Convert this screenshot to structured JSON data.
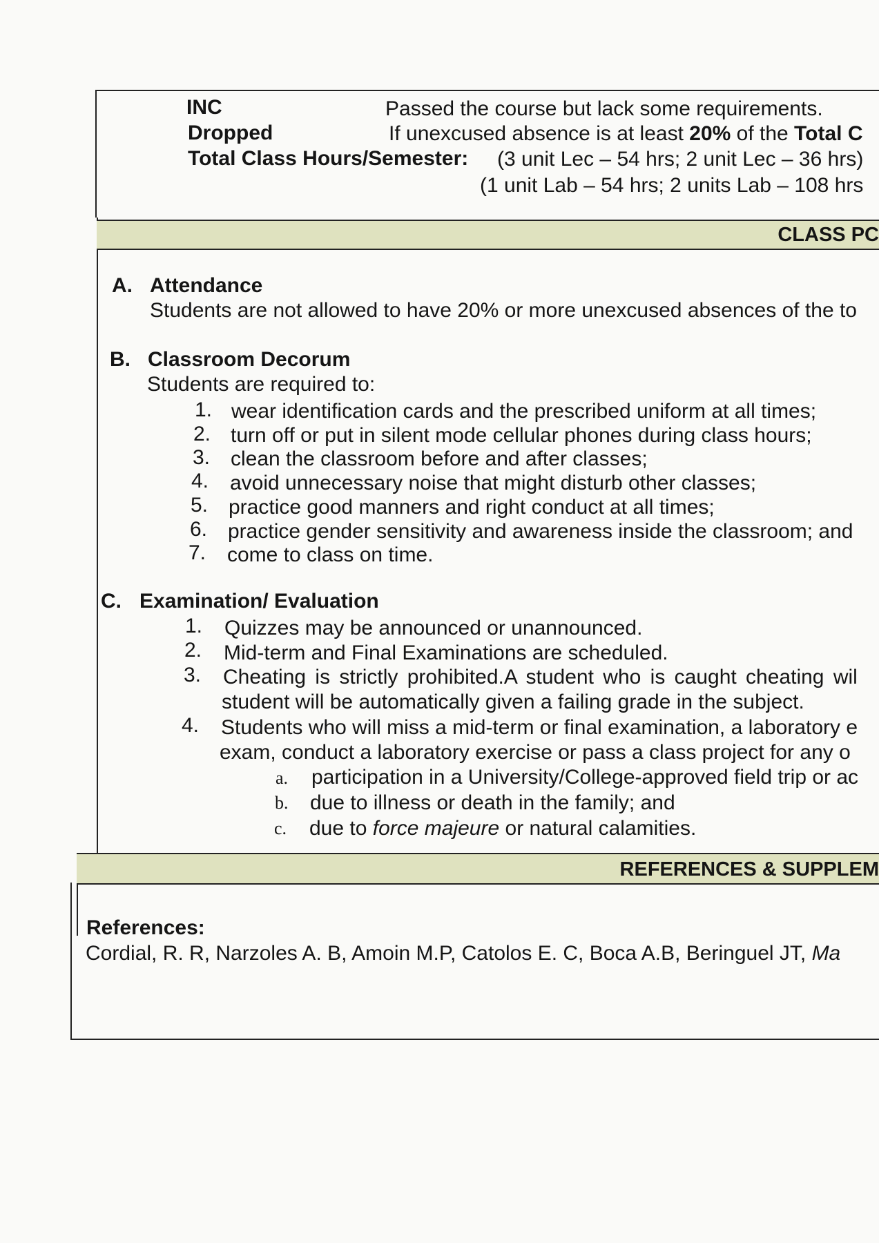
{
  "grading": {
    "inc_label": "INC",
    "inc_desc": "Passed the course but lack some requirements.",
    "dropped_label": "Dropped",
    "dropped_desc_prefix": "If unexcused absence is at least ",
    "dropped_desc_bold1": "20%",
    "dropped_desc_mid": " of the ",
    "dropped_desc_bold2": "Total C",
    "hours_label": "Total Class Hours/Semester:",
    "hours_lec": "(3 unit Lec – 54 hrs; 2 unit Lec – 36 hrs)",
    "hours_lab": "(1 unit Lab – 54 hrs; 2 units Lab – 108 hrs"
  },
  "class_policy": {
    "band_title": "CLASS PC",
    "attendance": {
      "heading_letter": "A.",
      "heading": "Attendance",
      "text": "Students are not allowed to have 20% or more unexcused absences of the to"
    },
    "decorum": {
      "heading_letter": "B.",
      "heading": "Classroom Decorum",
      "intro": "Students are required to:",
      "items": [
        {
          "num": "1.",
          "text": "wear identification cards and the prescribed uniform at all times;"
        },
        {
          "num": "2.",
          "text": "turn off or put in silent mode cellular phones during class hours;"
        },
        {
          "num": "3.",
          "text": "clean the classroom before and after classes;"
        },
        {
          "num": "4.",
          "text": "avoid unnecessary noise that might disturb other classes;"
        },
        {
          "num": "5.",
          "text": "practice good manners and right conduct at all times;"
        },
        {
          "num": "6.",
          "text": "practice gender sensitivity and awareness inside the classroom; and"
        },
        {
          "num": "7.",
          "text": "come to class on time."
        }
      ]
    },
    "exam": {
      "heading_letter": "C.",
      "heading": "Examination/ Evaluation",
      "items": [
        {
          "num": "1.",
          "text": "Quizzes may be announced or unannounced."
        },
        {
          "num": "2.",
          "text": "Mid-term and Final Examinations are scheduled."
        },
        {
          "num": "3.",
          "text": "Cheating is strictly prohibited.A student who is caught cheating wil",
          "text2": "student will be automatically given a failing grade in the subject."
        },
        {
          "num": "4.",
          "text": "Students who will miss a mid-term or final examination, a laboratory e",
          "text2": "exam, conduct a laboratory exercise or pass a class project for any o"
        }
      ],
      "subitems": [
        {
          "letter": "a.",
          "text": "participation in a University/College-approved field trip or ac"
        },
        {
          "letter": "b.",
          "text": "due to illness or death in the family; and"
        },
        {
          "letter": "c.",
          "text_pre": "due to ",
          "text_italic": "force majeure",
          "text_post": " or natural calamities."
        }
      ]
    }
  },
  "references_section": {
    "band_title": "REFERENCES & SUPPLEM",
    "heading": "References:",
    "citation": "Cordial, R. R, Narzoles A. B, Amoin M.P, Catolos E. C, Boca A.B, Beringuel JT, ",
    "citation_italic": "Ma"
  }
}
